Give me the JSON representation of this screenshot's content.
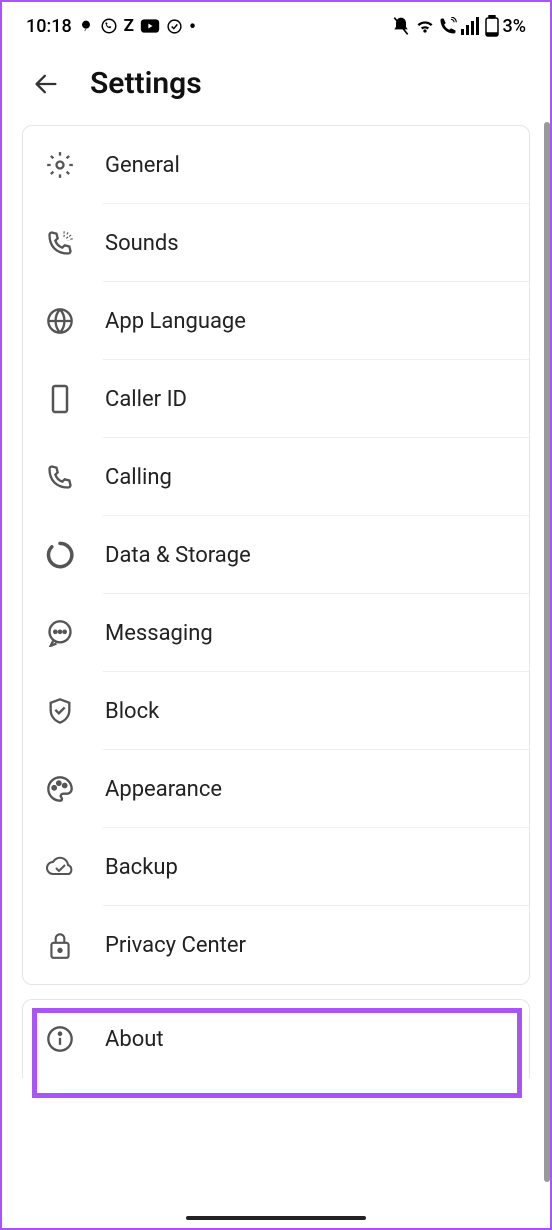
{
  "status": {
    "time": "10:18",
    "battery": "3%"
  },
  "header": {
    "title": "Settings"
  },
  "items": [
    {
      "label": "General",
      "icon": "gear"
    },
    {
      "label": "Sounds",
      "icon": "phone-sound"
    },
    {
      "label": "App Language",
      "icon": "globe"
    },
    {
      "label": "Caller ID",
      "icon": "device"
    },
    {
      "label": "Calling",
      "icon": "phone"
    },
    {
      "label": "Data & Storage",
      "icon": "data-ring"
    },
    {
      "label": "Messaging",
      "icon": "chat"
    },
    {
      "label": "Block",
      "icon": "shield"
    },
    {
      "label": "Appearance",
      "icon": "palette"
    },
    {
      "label": "Backup",
      "icon": "cloud-check"
    },
    {
      "label": "Privacy Center",
      "icon": "lock"
    }
  ],
  "items2": [
    {
      "label": "About",
      "icon": "info"
    }
  ]
}
